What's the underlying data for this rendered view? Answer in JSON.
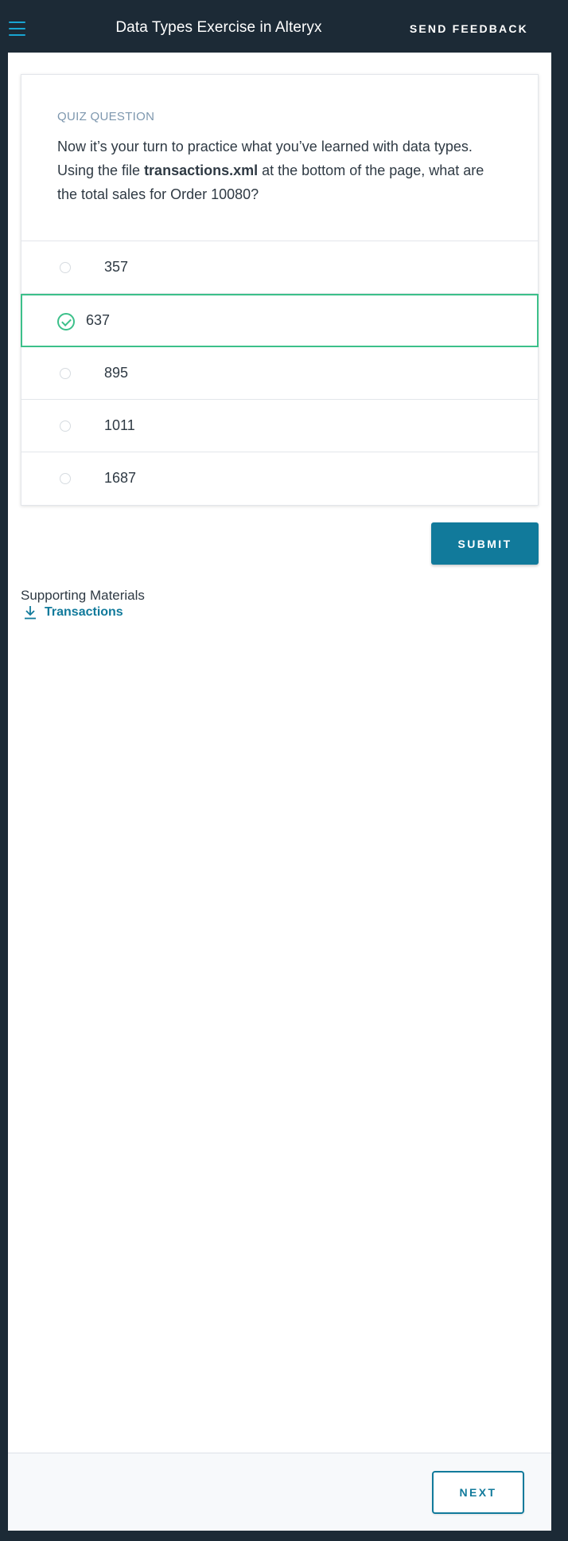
{
  "header": {
    "title": "Data Types Exercise in Alteryx",
    "feedback_label": "SEND FEEDBACK"
  },
  "quiz": {
    "label": "QUIZ QUESTION",
    "question_before": "Now it’s your turn to practice what you’ve learned with data types. Using the file ",
    "question_bold": "transactions.xml",
    "question_after": " at the bottom of the page, what are the total sales for Order 10080?",
    "options": [
      {
        "label": "357",
        "selected": false
      },
      {
        "label": "637",
        "selected": true
      },
      {
        "label": "895",
        "selected": false
      },
      {
        "label": "1011",
        "selected": false
      },
      {
        "label": "1687",
        "selected": false
      }
    ],
    "submit_label": "SUBMIT"
  },
  "supporting": {
    "title": "Supporting Materials",
    "link_label": "Transactions"
  },
  "footer": {
    "next_label": "NEXT"
  },
  "colors": {
    "accent": "#117a9b",
    "selected": "#3cc08a",
    "menu_icon": "#18a5d2",
    "topbar": "#1c2a36"
  }
}
